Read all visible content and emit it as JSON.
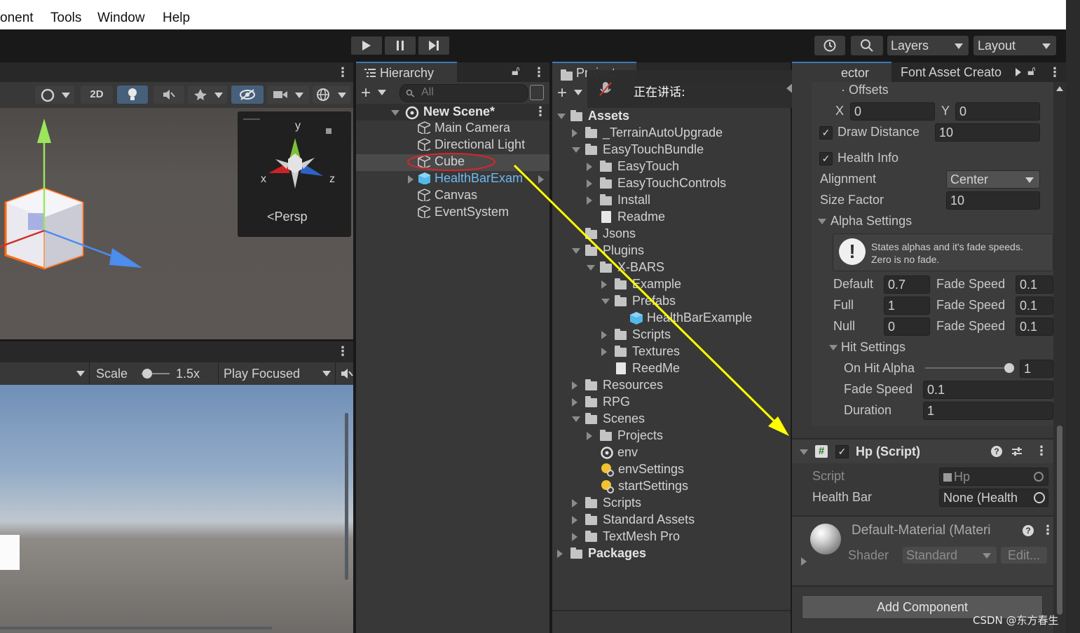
{
  "menu": {
    "items": [
      "onent",
      "Tools",
      "Window",
      "Help"
    ]
  },
  "toolbar": {
    "layers_label": "Layers",
    "layout_label": "Layout"
  },
  "scene_view": {
    "mode_2d": "2D",
    "gizmo_y": "y",
    "gizmo_x": "x",
    "gizmo_z": "z",
    "persp_label": "Persp"
  },
  "game_view": {
    "scale_label": "Scale",
    "scale_value": "1.5x",
    "play_mode": "Play Focused"
  },
  "hierarchy": {
    "tab_label": "Hierarchy",
    "search_placeholder": "All",
    "scene_name": "New Scene*",
    "items": [
      "Main Camera",
      "Directional Light",
      "Cube",
      "HealthBarExam",
      "Canvas",
      "EventSystem"
    ]
  },
  "project": {
    "tab_label": "Project",
    "overlay_text": "正在讲话:",
    "tree": [
      {
        "label": "Assets",
        "depth": 0,
        "type": "folder-open",
        "bold": true
      },
      {
        "label": "_TerrainAutoUpgrade",
        "depth": 1,
        "type": "folder"
      },
      {
        "label": "EasyTouchBundle",
        "depth": 1,
        "type": "folder-open"
      },
      {
        "label": "EasyTouch",
        "depth": 2,
        "type": "folder"
      },
      {
        "label": "EasyTouchControls",
        "depth": 2,
        "type": "folder"
      },
      {
        "label": "Install",
        "depth": 2,
        "type": "folder"
      },
      {
        "label": "Readme",
        "depth": 2,
        "type": "file"
      },
      {
        "label": "Jsons",
        "depth": 1,
        "type": "folder-empty"
      },
      {
        "label": "Plugins",
        "depth": 1,
        "type": "folder-open"
      },
      {
        "label": "X-BARS",
        "depth": 2,
        "type": "folder-open"
      },
      {
        "label": "Example",
        "depth": 3,
        "type": "folder"
      },
      {
        "label": "Prefabs",
        "depth": 3,
        "type": "folder-open"
      },
      {
        "label": "HealthBarExample",
        "depth": 4,
        "type": "prefab"
      },
      {
        "label": "Scripts",
        "depth": 3,
        "type": "folder"
      },
      {
        "label": "Textures",
        "depth": 3,
        "type": "folder"
      },
      {
        "label": "ReedMe",
        "depth": 3,
        "type": "file"
      },
      {
        "label": "Resources",
        "depth": 1,
        "type": "folder"
      },
      {
        "label": "RPG",
        "depth": 1,
        "type": "folder"
      },
      {
        "label": "Scenes",
        "depth": 1,
        "type": "folder-open"
      },
      {
        "label": "Projects",
        "depth": 2,
        "type": "folder"
      },
      {
        "label": "env",
        "depth": 2,
        "type": "unity"
      },
      {
        "label": "envSettings",
        "depth": 2,
        "type": "settings"
      },
      {
        "label": "startSettings",
        "depth": 2,
        "type": "settings"
      },
      {
        "label": "Scripts",
        "depth": 1,
        "type": "folder"
      },
      {
        "label": "Standard Assets",
        "depth": 1,
        "type": "folder"
      },
      {
        "label": "TextMesh Pro",
        "depth": 1,
        "type": "folder"
      },
      {
        "label": "Packages",
        "depth": 0,
        "type": "folder",
        "bold": true
      }
    ]
  },
  "inspector": {
    "tab_label": "ector",
    "tab2_label": "Font Asset Creato",
    "offsets_label": "Offsets",
    "x_label": "X",
    "x_value": "0",
    "y_label": "Y",
    "y_value": "0",
    "draw_distance_label": "Draw Distance",
    "draw_distance_value": "10",
    "health_info_label": "Health Info",
    "alignment_label": "Alignment",
    "alignment_value": "Center",
    "size_factor_label": "Size Factor",
    "size_factor_value": "10",
    "alpha_settings_label": "Alpha Settings",
    "help_text_1": "States alphas and it's fade speeds.",
    "help_text_2": "Zero is no fade.",
    "default_label": "Default",
    "default_value": "0.7",
    "default_fade_label": "Fade Speed",
    "default_fade_value": "0.1",
    "full_label": "Full",
    "full_value": "1",
    "full_fade_label": "Fade Speed",
    "full_fade_value": "0.1",
    "null_label": "Null",
    "null_value": "0",
    "null_fade_label": "Fade Speed",
    "null_fade_value": "0.1",
    "hit_settings_label": "Hit Settings",
    "on_hit_alpha_label": "On Hit Alpha",
    "on_hit_alpha_value": "1",
    "on_hit_alpha_fraction": 1.0,
    "fade_speed_label": "Fade Speed",
    "fade_speed_value": "0.1",
    "duration_label": "Duration",
    "duration_value": "1",
    "hp_component_title": "Hp (Script)",
    "script_label": "Script",
    "script_value": "Hp",
    "health_bar_label": "Health Bar",
    "health_bar_value": "None (Health",
    "material_title": "Default-Material (Materi",
    "shader_label": "Shader",
    "shader_value": "Standard",
    "edit_label": "Edit...",
    "add_component_label": "Add Component"
  },
  "watermark": "CSDN @东方春生"
}
